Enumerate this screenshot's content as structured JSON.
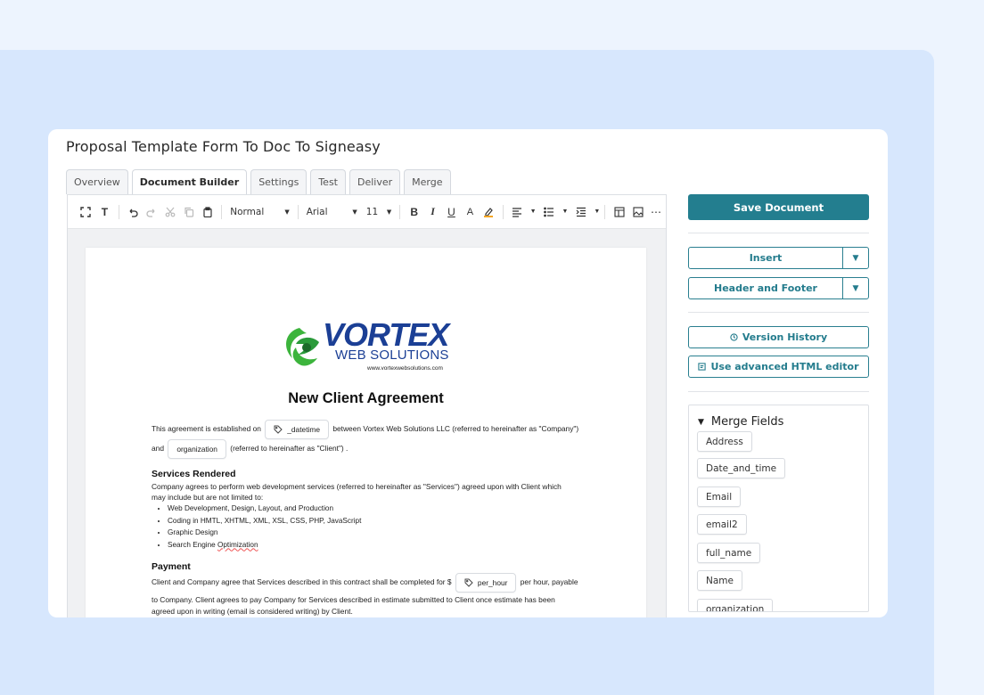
{
  "window": {
    "title": "Proposal Template Form To Doc To Signeasy"
  },
  "tabs": [
    "Overview",
    "Document Builder",
    "Settings",
    "Test",
    "Deliver",
    "Merge"
  ],
  "toolbar": {
    "style_value": "Normal",
    "font_value": "Arial",
    "size_value": "11",
    "icons": [
      "fullscreen-icon",
      "text-icon",
      "undo-icon",
      "redo-icon",
      "cut-icon",
      "copy-icon",
      "paste-icon",
      "bold-icon",
      "italic-icon",
      "underline-icon",
      "font-color-icon",
      "highlight-icon",
      "align-icon",
      "list-icon",
      "indent-icon",
      "table-icon",
      "image-icon",
      "more-icon"
    ]
  },
  "document": {
    "logo": {
      "main": "VORTEX",
      "sub": "WEB SOLUTIONS",
      "url": "www.vortexwebsolutions.com",
      "brand_green": "#3cb43c",
      "brand_blue": "#1b3f95"
    },
    "title": "New Client Agreement",
    "intro_1a": "This agreement is established on",
    "chip_datetime": "_datetime",
    "intro_1b": "between Vortex Web Solutions LLC (referred to hereinafter as \"Company\")",
    "intro_2a": "and",
    "chip_organization": "organization",
    "intro_2b": "(referred to hereinafter as \"Client\") .",
    "services_heading": "Services Rendered",
    "services_line1": "Company agrees to perform web development services (referred to hereinafter as \"Services\") agreed upon with Client which",
    "services_line2": "may include but are not limited to:",
    "services_items": [
      "Web Development, Design, Layout, and Production",
      "Coding in HMTL, XHTML, XML, XSL, CSS, PHP, JavaScript",
      "Graphic Design",
      "Search Engine "
    ],
    "services_item4_squiggle": "Optimization",
    "payment_heading": "Payment",
    "payment_1a": "Client and Company agree that Services described in this contract shall be completed for $",
    "chip_per_hour": "per_hour",
    "payment_1b": "per hour, payable",
    "payment_2": "to Company. Client agrees to pay Company for Services described in estimate submitted to Client once estimate has been",
    "payment_3": "agreed upon in writing (email is considered writing) by Client."
  },
  "sidebar": {
    "save_label": "Save Document",
    "insert_label": "Insert",
    "header_footer_label": "Header and Footer",
    "version_history_label": "Version History",
    "html_editor_label": "Use advanced HTML editor",
    "merge_fields_title": "Merge Fields",
    "merge_fields": [
      "Address",
      "Date_and_time",
      "Email",
      "email2",
      "full_name",
      "Name",
      "organization"
    ]
  },
  "colors": {
    "accent": "#237e8f",
    "bg_outer": "#edf4fe",
    "bg_panel": "#d7e7fd"
  }
}
